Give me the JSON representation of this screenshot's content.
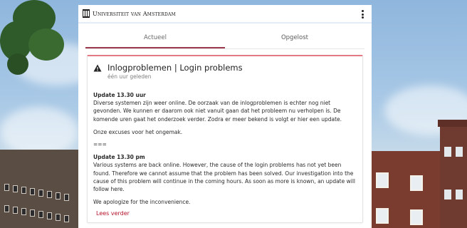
{
  "header": {
    "logo_text": "Universiteit van Amsterdam",
    "menu_icon": "kebab-menu-icon"
  },
  "tabs": [
    {
      "label": "Actueel",
      "active": true
    },
    {
      "label": "Opgelost",
      "active": false
    }
  ],
  "notice": {
    "icon": "warning-icon",
    "title": "Inlogproblemen | Login problems",
    "subtitle": "één uur geleden",
    "dutch": {
      "heading": "Update 13.30 uur",
      "text": "Diverse systemen zijn weer online. De oorzaak van de inlogproblemen is echter nog niet gevonden. We kunnen er daarom ook niet vanuit gaan dat het probleem nu verholpen is. De komende uren gaat het onderzoek verder. Zodra er meer bekend is volgt er hier een update.",
      "apology": "Onze excuses voor het ongemak."
    },
    "separator": "===",
    "english": {
      "heading": "Update 13.30 pm",
      "text": "Various systems are back online. However, the cause of the login problems has not yet been found. Therefore we cannot assume that the problem has been solved. Our investigation into the cause of this problem will continue in the coming hours. As soon as more is known, an update will follow here.",
      "apology": "We apologize for the inconvenience."
    },
    "more_label": "Lees verder"
  },
  "colors": {
    "accent": "#9b3a4f",
    "link": "#b4132a",
    "card_top_border": "#e27a84"
  }
}
